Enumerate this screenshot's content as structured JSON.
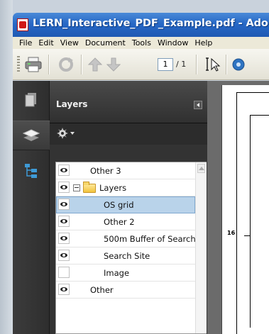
{
  "window": {
    "title": "LERN_Interactive_PDF_Example.pdf - Adobe R"
  },
  "menubar": {
    "items": [
      "File",
      "Edit",
      "View",
      "Document",
      "Tools",
      "Window",
      "Help"
    ]
  },
  "toolbar": {
    "page_current": "1",
    "page_total": "/ 1"
  },
  "layers_panel": {
    "title": "Layers",
    "layers": [
      {
        "label": "Other 3",
        "visible": true
      },
      {
        "label": "Layers",
        "visible": true,
        "expanded": true,
        "is_group": true
      },
      {
        "label": "OS grid",
        "visible": true,
        "selected": true
      },
      {
        "label": "Other 2",
        "visible": true
      },
      {
        "label": "500m Buffer of Search",
        "visible": true
      },
      {
        "label": "Search Site",
        "visible": true
      },
      {
        "label": "Image",
        "visible": false
      },
      {
        "label": "Other",
        "visible": true
      }
    ]
  },
  "document": {
    "tick_label": "16"
  },
  "icons": [
    "pdf-icon",
    "printer-icon",
    "refresh-icon",
    "up-arrow-icon",
    "down-arrow-icon",
    "select-cursor-icon",
    "pages-icon",
    "layers-icon",
    "tree-icon",
    "gear-icon",
    "eye-icon",
    "folder-icon"
  ]
}
